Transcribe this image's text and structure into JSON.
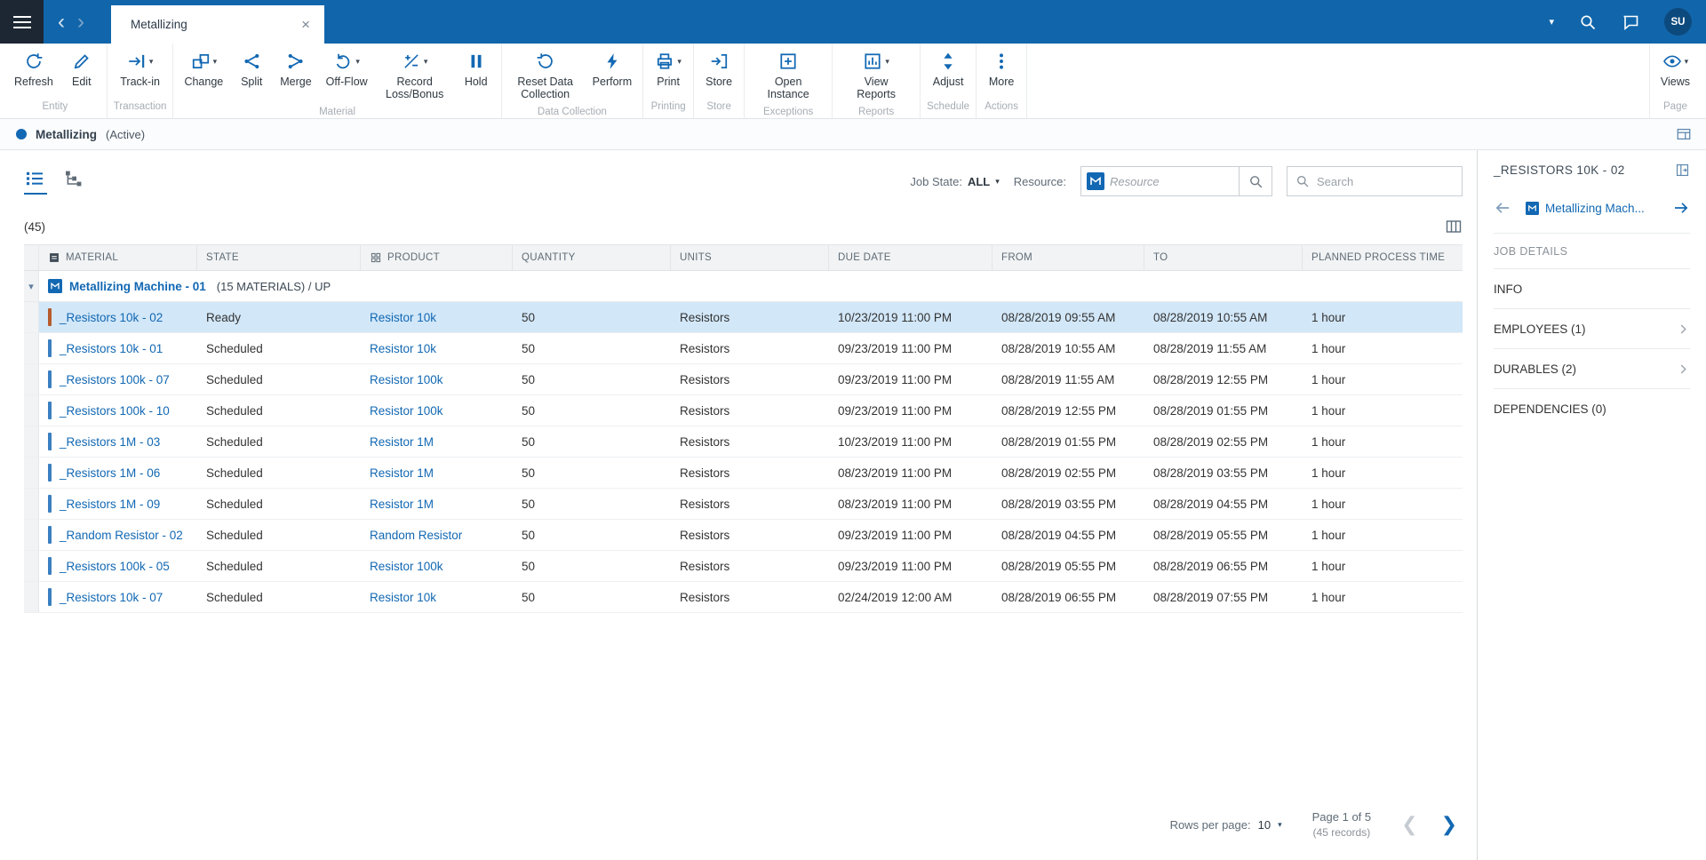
{
  "colors": {
    "accent": "#1268b3",
    "topbar_bg": "#1166ab",
    "menu_bg": "#1c2733",
    "selected_row_bg": "#d2e7f8"
  },
  "topbar": {
    "tab_title": "Metallizing",
    "avatar": "SU"
  },
  "toolbar": {
    "groups": [
      {
        "label": "Entity",
        "buttons": [
          {
            "label": "Refresh",
            "icon": "refresh-icon",
            "caret": false
          },
          {
            "label": "Edit",
            "icon": "edit-icon",
            "caret": false
          }
        ]
      },
      {
        "label": "Transaction",
        "buttons": [
          {
            "label": "Track-in",
            "icon": "track-in-icon",
            "caret": true
          }
        ]
      },
      {
        "label": "Material",
        "buttons": [
          {
            "label": "Change",
            "icon": "change-icon",
            "caret": true
          },
          {
            "label": "Split",
            "icon": "split-icon",
            "caret": false
          },
          {
            "label": "Merge",
            "icon": "merge-icon",
            "caret": false
          },
          {
            "label": "Off-Flow",
            "icon": "off-flow-icon",
            "caret": true
          },
          {
            "label": "Record Loss/Bonus",
            "icon": "record-loss-bonus-icon",
            "caret": true
          },
          {
            "label": "Hold",
            "icon": "hold-icon",
            "caret": false
          }
        ]
      },
      {
        "label": "Data Collection",
        "buttons": [
          {
            "label": "Reset Data Collection",
            "icon": "reset-data-collection-icon",
            "caret": false
          },
          {
            "label": "Perform",
            "icon": "perform-icon",
            "caret": false
          }
        ]
      },
      {
        "label": "Printing",
        "buttons": [
          {
            "label": "Print",
            "icon": "print-icon",
            "caret": true
          }
        ]
      },
      {
        "label": "Store",
        "buttons": [
          {
            "label": "Store",
            "icon": "store-icon",
            "caret": false
          }
        ]
      },
      {
        "label": "Exceptions",
        "buttons": [
          {
            "label": "Open Instance",
            "icon": "open-instance-icon",
            "caret": false
          }
        ]
      },
      {
        "label": "Reports",
        "buttons": [
          {
            "label": "View Reports",
            "icon": "view-reports-icon",
            "caret": true
          }
        ]
      },
      {
        "label": "Schedule",
        "buttons": [
          {
            "label": "Adjust",
            "icon": "adjust-icon",
            "caret": false
          }
        ]
      },
      {
        "label": "Actions",
        "buttons": [
          {
            "label": "More",
            "icon": "more-icon",
            "caret": false
          }
        ]
      }
    ],
    "page_group": {
      "label": "Page",
      "buttons": [
        {
          "label": "Views",
          "icon": "views-icon",
          "caret": true
        }
      ]
    }
  },
  "subheader": {
    "title": "Metallizing",
    "status": "(Active)"
  },
  "filters": {
    "job_state_label": "Job State:",
    "job_state_value": "ALL",
    "resource_label": "Resource:",
    "resource_placeholder": "Resource",
    "search_placeholder": "Search"
  },
  "table": {
    "count": "(45)",
    "columns": [
      "MATERIAL",
      "STATE",
      "PRODUCT",
      "QUANTITY",
      "UNITS",
      "DUE DATE",
      "FROM",
      "TO",
      "PLANNED PROCESS TIME"
    ],
    "group": {
      "name": "Metallizing Machine - 01",
      "meta": "(15 MATERIALS) /  UP"
    },
    "rows": [
      {
        "material": "_Resistors 10k - 02",
        "state": "Ready",
        "product": "Resistor 10k",
        "quantity": "50",
        "units": "Resistors",
        "due_date": "10/23/2019 11:00 PM",
        "from": "08/28/2019 09:55 AM",
        "to": "08/28/2019 10:55 AM",
        "planned_time": "1 hour",
        "selected": true,
        "bar_color": "#b65c2e"
      },
      {
        "material": "_Resistors 10k - 01",
        "state": "Scheduled",
        "product": "Resistor 10k",
        "quantity": "50",
        "units": "Resistors",
        "due_date": "09/23/2019 11:00 PM",
        "from": "08/28/2019 10:55 AM",
        "to": "08/28/2019 11:55 AM",
        "planned_time": "1 hour",
        "selected": false,
        "bar_color": "#3a7fc1"
      },
      {
        "material": "_Resistors 100k - 07",
        "state": "Scheduled",
        "product": "Resistor 100k",
        "quantity": "50",
        "units": "Resistors",
        "due_date": "09/23/2019 11:00 PM",
        "from": "08/28/2019 11:55 AM",
        "to": "08/28/2019 12:55 PM",
        "planned_time": "1 hour",
        "selected": false,
        "bar_color": "#3a7fc1"
      },
      {
        "material": "_Resistors 100k - 10",
        "state": "Scheduled",
        "product": "Resistor 100k",
        "quantity": "50",
        "units": "Resistors",
        "due_date": "09/23/2019 11:00 PM",
        "from": "08/28/2019 12:55 PM",
        "to": "08/28/2019 01:55 PM",
        "planned_time": "1 hour",
        "selected": false,
        "bar_color": "#3a7fc1"
      },
      {
        "material": "_Resistors 1M - 03",
        "state": "Scheduled",
        "product": "Resistor 1M",
        "quantity": "50",
        "units": "Resistors",
        "due_date": "10/23/2019 11:00 PM",
        "from": "08/28/2019 01:55 PM",
        "to": "08/28/2019 02:55 PM",
        "planned_time": "1 hour",
        "selected": false,
        "bar_color": "#3a7fc1"
      },
      {
        "material": "_Resistors 1M - 06",
        "state": "Scheduled",
        "product": "Resistor 1M",
        "quantity": "50",
        "units": "Resistors",
        "due_date": "08/23/2019 11:00 PM",
        "from": "08/28/2019 02:55 PM",
        "to": "08/28/2019 03:55 PM",
        "planned_time": "1 hour",
        "selected": false,
        "bar_color": "#3a7fc1"
      },
      {
        "material": "_Resistors 1M - 09",
        "state": "Scheduled",
        "product": "Resistor 1M",
        "quantity": "50",
        "units": "Resistors",
        "due_date": "08/23/2019 11:00 PM",
        "from": "08/28/2019 03:55 PM",
        "to": "08/28/2019 04:55 PM",
        "planned_time": "1 hour",
        "selected": false,
        "bar_color": "#3a7fc1"
      },
      {
        "material": "_Random Resistor - 02",
        "state": "Scheduled",
        "product": "Random Resistor",
        "quantity": "50",
        "units": "Resistors",
        "due_date": "09/23/2019 11:00 PM",
        "from": "08/28/2019 04:55 PM",
        "to": "08/28/2019 05:55 PM",
        "planned_time": "1 hour",
        "selected": false,
        "bar_color": "#3a7fc1"
      },
      {
        "material": "_Resistors 100k - 05",
        "state": "Scheduled",
        "product": "Resistor 100k",
        "quantity": "50",
        "units": "Resistors",
        "due_date": "09/23/2019 11:00 PM",
        "from": "08/28/2019 05:55 PM",
        "to": "08/28/2019 06:55 PM",
        "planned_time": "1 hour",
        "selected": false,
        "bar_color": "#3a7fc1"
      },
      {
        "material": "_Resistors 10k - 07",
        "state": "Scheduled",
        "product": "Resistor 10k",
        "quantity": "50",
        "units": "Resistors",
        "due_date": "02/24/2019 12:00 AM",
        "from": "08/28/2019 06:55 PM",
        "to": "08/28/2019 07:55 PM",
        "planned_time": "1 hour",
        "selected": false,
        "bar_color": "#3a7fc1"
      }
    ]
  },
  "pagination": {
    "rows_per_page_label": "Rows per page:",
    "rows_per_page_value": "10",
    "page_info": "Page 1 of 5",
    "records_info": "(45 records)"
  },
  "sidebar": {
    "title": "_RESISTORS 10K - 02",
    "resource_link": "Metallizing Mach...",
    "section_label": "JOB DETAILS",
    "items": [
      {
        "label": "INFO",
        "chevron": false
      },
      {
        "label": "EMPLOYEES (1)",
        "chevron": true
      },
      {
        "label": "DURABLES (2)",
        "chevron": true
      },
      {
        "label": "DEPENDENCIES (0)",
        "chevron": false
      }
    ]
  }
}
